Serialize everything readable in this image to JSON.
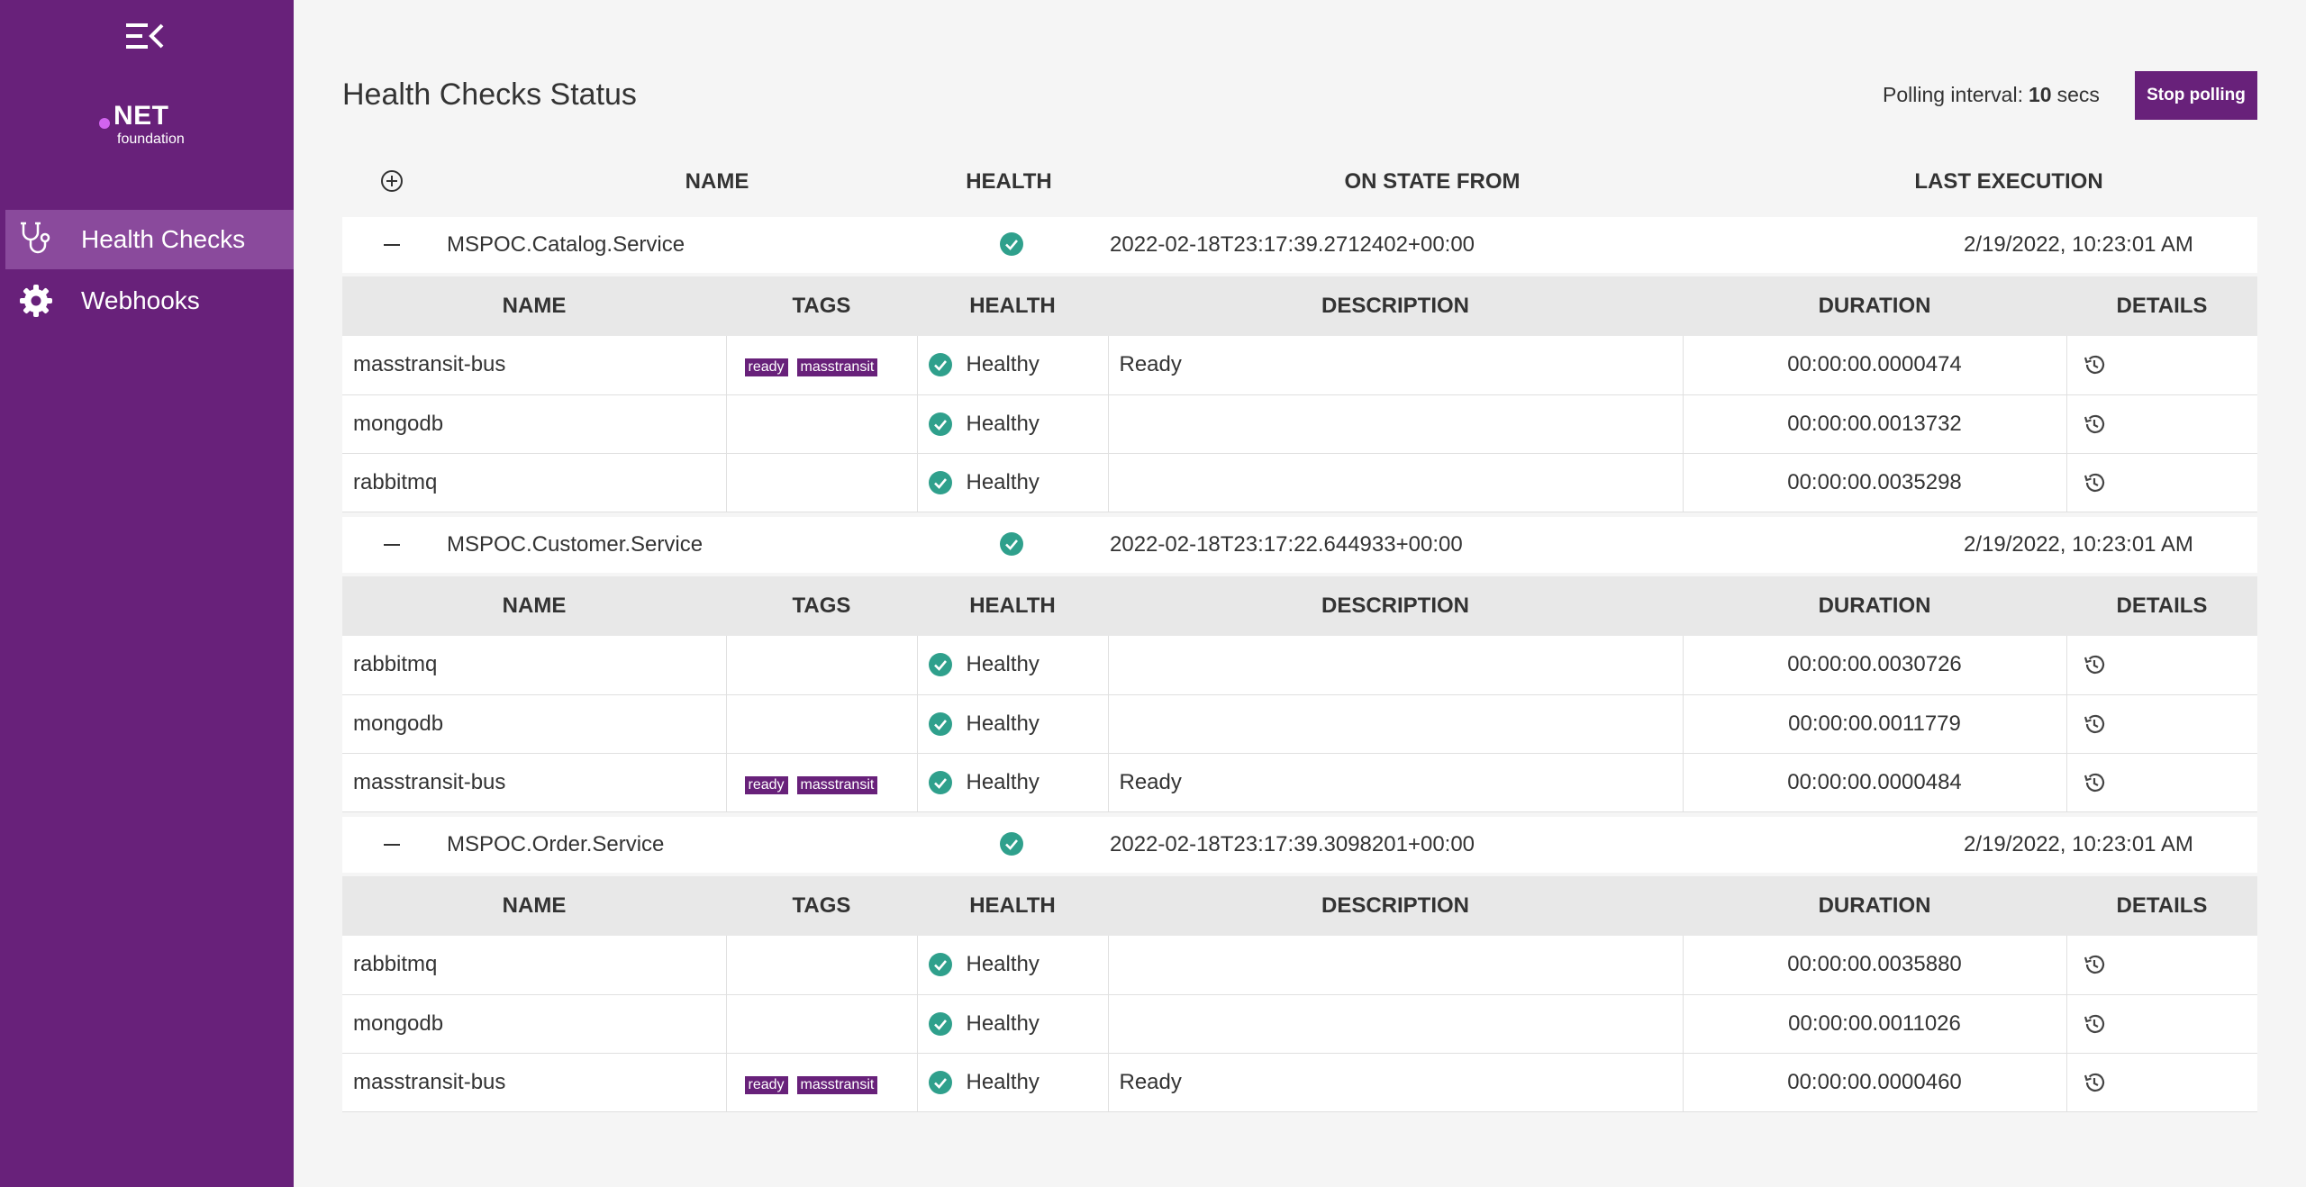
{
  "colors": {
    "brand": "#68217a",
    "brand_light": "#8a4a9c",
    "healthy": "#2fa08c"
  },
  "sidebar": {
    "logo": {
      "net": "NET",
      "foundation": "foundation"
    },
    "items": [
      {
        "label": "Health Checks",
        "icon": "stethoscope-icon",
        "active": true
      },
      {
        "label": "Webhooks",
        "icon": "gear-icon",
        "active": false
      }
    ]
  },
  "header": {
    "title": "Health Checks Status",
    "polling_prefix": "Polling interval:",
    "polling_value": "10",
    "polling_unit": "secs",
    "stop_button": "Stop polling"
  },
  "columns": {
    "name": "NAME",
    "health": "HEALTH",
    "on_state_from": "ON STATE FROM",
    "last_execution": "LAST EXECUTION"
  },
  "detail_columns": {
    "name": "NAME",
    "tags": "TAGS",
    "health": "HEALTH",
    "description": "DESCRIPTION",
    "duration": "DURATION",
    "details": "DETAILS"
  },
  "services": [
    {
      "name": "MSPOC.Catalog.Service",
      "on_state_from": "2022-02-18T23:17:39.2712402+00:00",
      "last_execution": "2/19/2022, 10:23:01 AM",
      "entries": [
        {
          "name": "masstransit-bus",
          "tags": [
            "ready",
            "masstransit"
          ],
          "health": "Healthy",
          "description": "Ready",
          "duration": "00:00:00.0000474"
        },
        {
          "name": "mongodb",
          "tags": [],
          "health": "Healthy",
          "description": "",
          "duration": "00:00:00.0013732"
        },
        {
          "name": "rabbitmq",
          "tags": [],
          "health": "Healthy",
          "description": "",
          "duration": "00:00:00.0035298"
        }
      ]
    },
    {
      "name": "MSPOC.Customer.Service",
      "on_state_from": "2022-02-18T23:17:22.644933+00:00",
      "last_execution": "2/19/2022, 10:23:01 AM",
      "entries": [
        {
          "name": "rabbitmq",
          "tags": [],
          "health": "Healthy",
          "description": "",
          "duration": "00:00:00.0030726"
        },
        {
          "name": "mongodb",
          "tags": [],
          "health": "Healthy",
          "description": "",
          "duration": "00:00:00.0011779"
        },
        {
          "name": "masstransit-bus",
          "tags": [
            "ready",
            "masstransit"
          ],
          "health": "Healthy",
          "description": "Ready",
          "duration": "00:00:00.0000484"
        }
      ]
    },
    {
      "name": "MSPOC.Order.Service",
      "on_state_from": "2022-02-18T23:17:39.3098201+00:00",
      "last_execution": "2/19/2022, 10:23:01 AM",
      "entries": [
        {
          "name": "rabbitmq",
          "tags": [],
          "health": "Healthy",
          "description": "",
          "duration": "00:00:00.0035880"
        },
        {
          "name": "mongodb",
          "tags": [],
          "health": "Healthy",
          "description": "",
          "duration": "00:00:00.0011026"
        },
        {
          "name": "masstransit-bus",
          "tags": [
            "ready",
            "masstransit"
          ],
          "health": "Healthy",
          "description": "Ready",
          "duration": "00:00:00.0000460"
        }
      ]
    }
  ]
}
